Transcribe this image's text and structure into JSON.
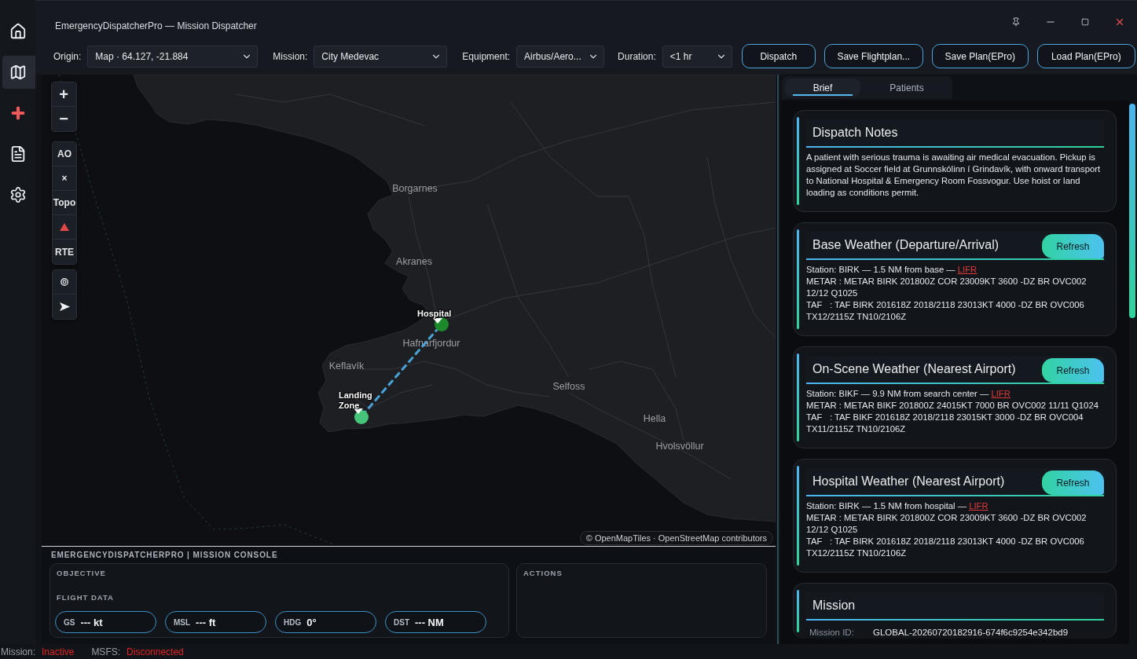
{
  "window": {
    "title": "EmergencyDispatcherPro — Mission Dispatcher"
  },
  "nav": [
    {
      "kind": "home",
      "selected": false
    },
    {
      "kind": "map",
      "selected": true
    },
    {
      "kind": "medical",
      "selected": false
    },
    {
      "kind": "document",
      "selected": false
    },
    {
      "kind": "settings",
      "selected": false
    }
  ],
  "toolbar": {
    "fields": [
      {
        "label": "Origin:",
        "value": "Map · 64.127, -21.884"
      },
      {
        "label": "Mission:",
        "value": "City Medevac"
      },
      {
        "label": "Equipment:",
        "value": "Airbus/Aero..."
      },
      {
        "label": "Duration:",
        "value": "<1 hr"
      }
    ],
    "buttons": [
      "Dispatch",
      "Save Flightplan...",
      "Save Plan(EPro)",
      "Load Plan(EPro)"
    ]
  },
  "map": {
    "control_groups": [
      [
        {
          "kind": "label",
          "label": "+"
        },
        {
          "kind": "label",
          "label": "−"
        }
      ],
      [
        {
          "kind": "label",
          "label": "AO"
        },
        {
          "kind": "label",
          "label": "×"
        },
        {
          "kind": "label",
          "label": "Topo"
        },
        {
          "kind": "triangle"
        },
        {
          "kind": "label",
          "label": "RTE"
        }
      ],
      [
        {
          "kind": "target"
        },
        {
          "kind": "pointer"
        }
      ]
    ],
    "places": [
      "Borgarnes",
      "Akranes",
      "Hafnarfjordur",
      "Keflavík",
      "Selfoss",
      "Hella",
      "Hvolsvöllur"
    ],
    "markers": [
      {
        "label": "Hospital",
        "color": "#1c8a2a"
      },
      {
        "label": "Landing Zone",
        "color": "#46c47a"
      }
    ],
    "attribution": "© OpenMapTiles · OpenStreetMap contributors"
  },
  "console": {
    "title": "EMERGENCYDISPATCHERPRO | MISSION CONSOLE",
    "objective": {
      "heading": "OBJECTIVE",
      "flight_data_heading": "FLIGHT DATA",
      "readouts": [
        {
          "label": "GS",
          "value": "--- kt"
        },
        {
          "label": "MSL",
          "value": "--- ft"
        },
        {
          "label": "HDG",
          "value": "0°"
        },
        {
          "label": "DST",
          "value": "--- NM"
        }
      ]
    },
    "actions": {
      "heading": "ACTIONS"
    }
  },
  "side_panel": {
    "tabs": [
      {
        "label": "Brief",
        "selected": true
      },
      {
        "label": "Patients",
        "selected": false
      }
    ],
    "cards": [
      {
        "kind": "notes",
        "title": "Dispatch Notes",
        "text": "A patient with serious trauma is awaiting air medical evacuation. Pickup is assigned at Soccer field at Grunnskólinn í Grindavík, with onward transport to National Hospital & Emergency Room Fossvogur. Use hoist or land loading as conditions permit."
      },
      {
        "kind": "weather",
        "title": "Base Weather (Departure/Arrival)",
        "button": "Refresh",
        "station": "Station: BIRK — 1.5 NM from base —",
        "category": "LIFR",
        "metar": "METAR : METAR BIRK 201800Z COR 23009KT 3600 -DZ BR OVC002 12/12 Q1025",
        "taf": "TAF   : TAF BIRK 201618Z 2018/2118 23013KT 4000 -DZ BR OVC006 TX12/2115Z TN10/2106Z"
      },
      {
        "kind": "weather",
        "title": "On-Scene Weather (Nearest Airport)",
        "button": "Refresh",
        "station": "Station: BIKF — 9.9 NM from search center —",
        "category": "LIFR",
        "metar": "METAR : METAR BIKF 201800Z 24015KT 7000 BR OVC002 11/11 Q1024",
        "taf": "TAF   : TAF BIKF 201618Z 2018/2118 23015KT 3000 -DZ BR OVC004 TX11/2115Z TN10/2106Z"
      },
      {
        "kind": "weather",
        "title": "Hospital Weather (Nearest Airport)",
        "button": "Refresh",
        "station": "Station: BIRK — 1.5 NM from hospital —",
        "category": "LIFR",
        "metar": "METAR : METAR BIRK 201800Z COR 23009KT 3600 -DZ BR OVC002 12/12 Q1025",
        "taf": "TAF   : TAF BIRK 201618Z 2018/2118 23013KT 4000 -DZ BR OVC006 TX12/2115Z TN10/2106Z"
      },
      {
        "kind": "mission",
        "title": "Mission",
        "fields": [
          {
            "label": "Mission ID:",
            "value": "GLOBAL-20260720182916-674f6c9254e342bd9"
          }
        ]
      }
    ]
  },
  "status": [
    {
      "label": "Mission:",
      "value": "Inactive"
    },
    {
      "label": "MSFS:",
      "value": "Disconnected"
    }
  ]
}
